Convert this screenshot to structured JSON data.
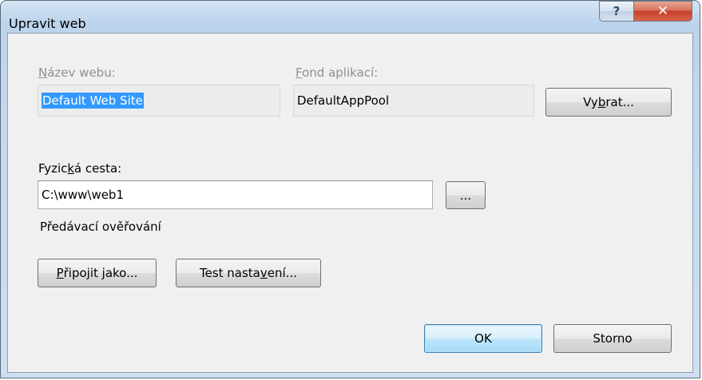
{
  "window": {
    "title": "Upravit web",
    "help_glyph": "?",
    "close_glyph": "✕"
  },
  "site_name": {
    "label_accel": "N",
    "label_rest": "ázev webu:",
    "value": "Default Web Site"
  },
  "app_pool": {
    "label_accel": "F",
    "label_rest": "ond aplikací:",
    "value": "DefaultAppPool",
    "select_button": {
      "pre": "Vy",
      "accel": "b",
      "post": "rat..."
    }
  },
  "physical_path": {
    "label_pre": "Fyzic",
    "label_accel": "k",
    "label_post": "á cesta:",
    "value": "C:\\www\\web1",
    "browse_label": "..."
  },
  "pass_through_auth": {
    "label": "Předávací ověřování",
    "connect_as": {
      "accel": "P",
      "post": "řipojit jako..."
    },
    "test_settings": {
      "pre": "Test nasta",
      "accel": "v",
      "post": "ení..."
    }
  },
  "footer": {
    "ok_label": "OK",
    "cancel_label": "Storno"
  },
  "colors": {
    "selection": "#3399ff",
    "default_button_border": "#3c7fb1",
    "close_button": "#c5402a"
  },
  "icons": [
    "help-icon",
    "close-icon"
  ]
}
